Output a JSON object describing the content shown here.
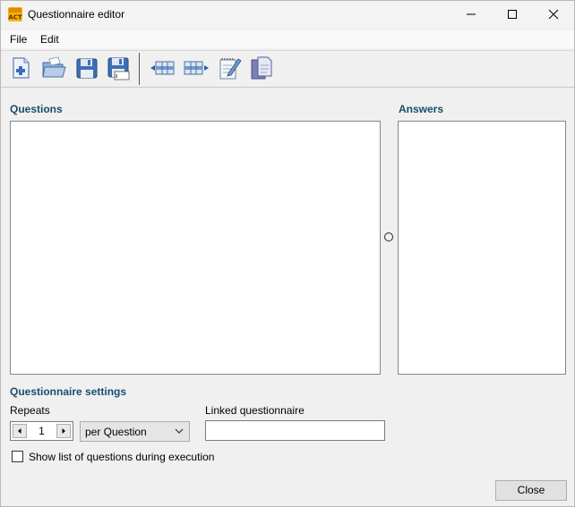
{
  "window": {
    "title": "Questionnaire editor",
    "app_icon_text": "ACT"
  },
  "menu": {
    "items": [
      "File",
      "Edit"
    ]
  },
  "toolbar": {
    "buttons": [
      "new-document-icon",
      "open-folder-icon",
      "save-icon",
      "save-as-icon",
      "add-column-left-icon",
      "add-column-right-icon",
      "edit-notepad-icon",
      "copy-document-icon"
    ]
  },
  "questions": {
    "label": "Questions"
  },
  "answers": {
    "label": "Answers"
  },
  "settings": {
    "label": "Questionnaire settings",
    "repeats_label": "Repeats",
    "repeats_value": "1",
    "repeat_mode": "per Question",
    "linked_label": "Linked questionnaire",
    "linked_value": "",
    "show_list_label": "Show list of questions during execution",
    "show_list_checked": false
  },
  "footer": {
    "close_label": "Close"
  }
}
